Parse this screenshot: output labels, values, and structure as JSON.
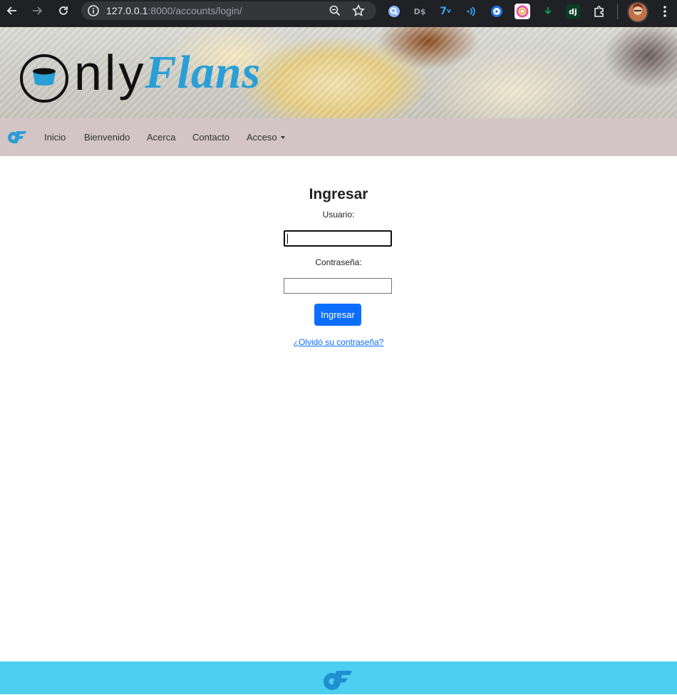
{
  "browser": {
    "url_host": "127.0.0.1",
    "url_rest": ":8000/accounts/login/",
    "extensions": [
      "search-lens",
      "dollar-s",
      "translate",
      "wifi",
      "play-circle",
      "color-circle",
      "download",
      "dj",
      "puzzle"
    ]
  },
  "brand": {
    "logo_word1": "nly",
    "logo_word2": "Flans",
    "accent": "#2a9fd6"
  },
  "navbar": {
    "items": [
      {
        "label": "Inicio"
      },
      {
        "label": "Bienvenido"
      },
      {
        "label": "Acerca"
      },
      {
        "label": "Contacto"
      },
      {
        "label": "Acceso"
      }
    ],
    "background": "#d3c5c5"
  },
  "login": {
    "title": "Ingresar",
    "username_label": "Usuario:",
    "username_value": "",
    "password_label": "Contraseña:",
    "password_value": "",
    "submit_label": "Ingresar",
    "forgot_label": "¿Olvidó su contraseña?",
    "button_color": "#0d6efd"
  },
  "footer": {
    "background": "#4dcff2"
  }
}
